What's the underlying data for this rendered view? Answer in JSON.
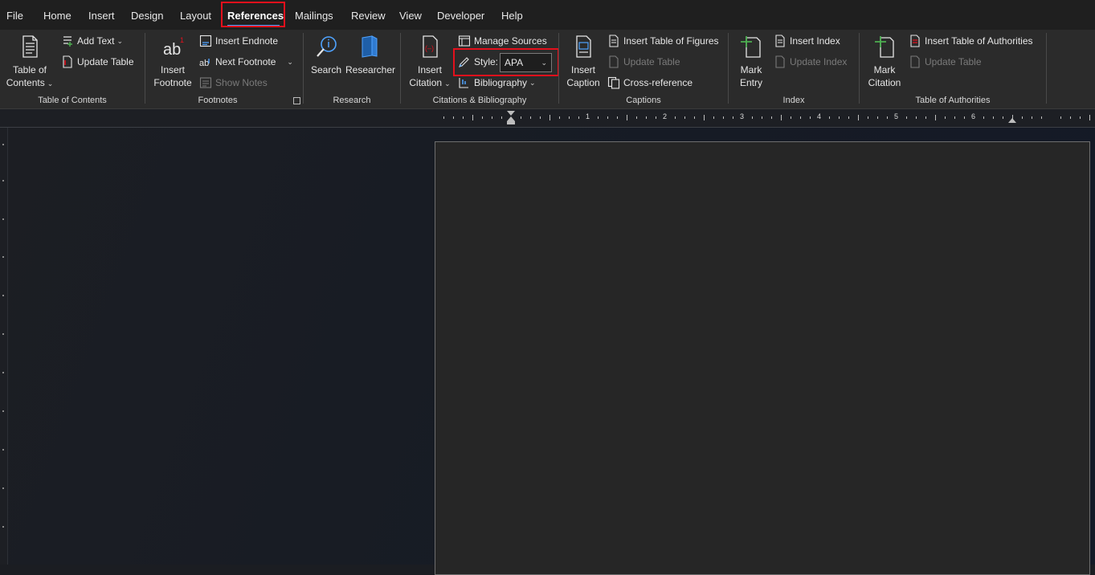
{
  "menu": {
    "tabs": [
      "File",
      "Home",
      "Insert",
      "Design",
      "Layout",
      "References",
      "Mailings",
      "Review",
      "View",
      "Developer",
      "Help"
    ],
    "active": "References"
  },
  "ribbon": {
    "toc": {
      "table_of_contents_line1": "Table of",
      "table_of_contents_line2": "Contents",
      "add_text": "Add Text",
      "update_table": "Update Table",
      "group_label": "Table of Contents"
    },
    "footnotes": {
      "insert_footnote_line1": "Insert",
      "insert_footnote_line2": "Footnote",
      "insert_endnote": "Insert Endnote",
      "next_footnote": "Next Footnote",
      "show_notes": "Show Notes",
      "group_label": "Footnotes",
      "icon_text": "ab",
      "icon_sup": "1",
      "next_icon_text": "ab"
    },
    "research": {
      "search": "Search",
      "researcher": "Researcher",
      "group_label": "Research"
    },
    "citations": {
      "insert_citation_line1": "Insert",
      "insert_citation_line2": "Citation",
      "manage_sources": "Manage Sources",
      "style_label": "Style:",
      "style_value": "APA",
      "bibliography": "Bibliography",
      "group_label": "Citations & Bibliography"
    },
    "captions": {
      "insert_caption_line1": "Insert",
      "insert_caption_line2": "Caption",
      "insert_table_of_figures": "Insert Table of Figures",
      "update_table": "Update Table",
      "cross_reference": "Cross-reference",
      "group_label": "Captions"
    },
    "index": {
      "mark_entry_line1": "Mark",
      "mark_entry_line2": "Entry",
      "insert_index": "Insert Index",
      "update_index": "Update Index",
      "group_label": "Index"
    },
    "authorities": {
      "mark_citation_line1": "Mark",
      "mark_citation_line2": "Citation",
      "insert_table_of_authorities": "Insert Table of Authorities",
      "update_table": "Update Table",
      "group_label": "Table of Authorities"
    }
  },
  "ruler": {
    "numbers": [
      "1",
      "2",
      "3",
      "4",
      "5",
      "6"
    ]
  },
  "colors": {
    "highlight": "#e3101c",
    "accent": "#4fa3ff",
    "ribbon_bg": "#2b2b2b",
    "page_bg": "#262626"
  }
}
